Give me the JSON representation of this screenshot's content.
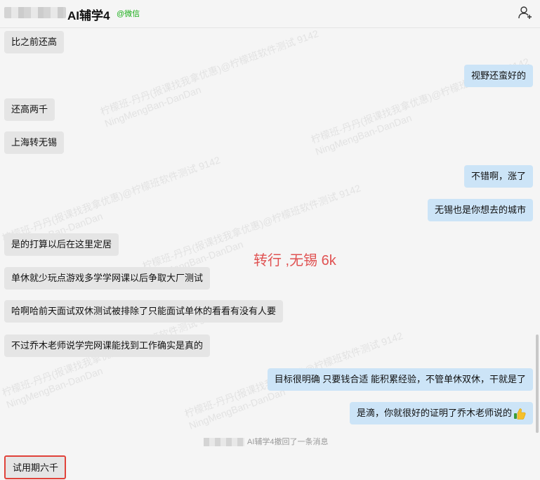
{
  "header": {
    "title": "AI辅学4",
    "source_tag": "@微信"
  },
  "watermark": {
    "line1": "柠檬班-丹丹(报课找我拿优惠)@柠檬班软件测试 9142",
    "line2": "NingMengBan-DanDan"
  },
  "messages": [
    {
      "side": "in",
      "text": "比之前还高"
    },
    {
      "side": "out",
      "text": "视野还蛮好的"
    },
    {
      "side": "in",
      "text": "还高两千"
    },
    {
      "side": "in",
      "text": "上海转无锡"
    },
    {
      "side": "out",
      "text": "不错啊，涨了"
    },
    {
      "side": "out",
      "text": "无锡也是你想去的城市"
    },
    {
      "side": "in",
      "text": "是的打算以后在这里定居"
    },
    {
      "side": "in",
      "text": "单休就少玩点游戏多学学网课以后争取大厂测试"
    },
    {
      "side": "in",
      "text": "哈啊哈前天面试双休测试被排除了只能面试单休的看看有没有人要"
    },
    {
      "side": "in",
      "text": "不过乔木老师说学完网课能找到工作确实是真的"
    },
    {
      "side": "out",
      "text": "目标很明确    只要钱合适  能积累经验，不管单休双休，干就是了"
    },
    {
      "side": "out",
      "text": "是滴，你就很好的证明了乔木老师说的",
      "emoji": "thumbs-up-icon"
    },
    {
      "side": "in",
      "text": "试用期六千"
    }
  ],
  "annotation": "转行 ,无锡 6k",
  "recall_notice": "AI辅学4撤回了一条消息",
  "colors": {
    "incoming_bubble": "#e5e5e5",
    "outgoing_bubble": "#cce4f7",
    "annotation": "#e05252",
    "highlight_border": "#e0423a",
    "wechat_tag": "#1aad19"
  }
}
